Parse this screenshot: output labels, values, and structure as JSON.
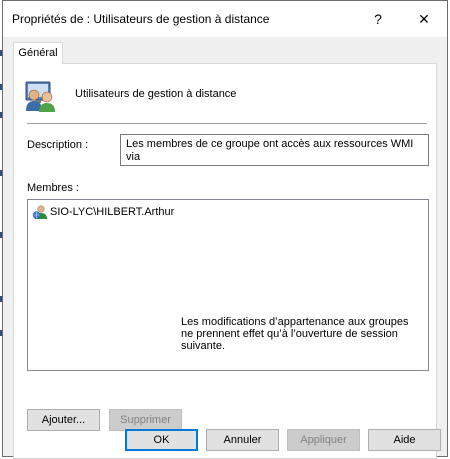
{
  "window": {
    "title": "Propriétés de : Utilisateurs de gestion à distance",
    "help_glyph": "?",
    "close_glyph": "✕"
  },
  "tabs": [
    {
      "label": "Général",
      "selected": true
    }
  ],
  "general": {
    "group_name": "Utilisateurs de gestion à distance",
    "description_label": "Description :",
    "description_value": "Les membres de ce groupe ont accès aux ressources WMI via\ndes protocoles de gestion (tels que  WS-Management via le",
    "members_label": "Membres :",
    "members": [
      {
        "name": "SIO-LYC\\HILBERT.Arthur",
        "icon": "user-domain-icon"
      }
    ],
    "add_button": "Ajouter...",
    "remove_button": "Supprimer",
    "note": "Les modifications d’appartenance aux groupes ne prennent effet qu’à l’ouverture de session suivante."
  },
  "footer": {
    "ok": "OK",
    "cancel": "Annuler",
    "apply": "Appliquer",
    "help": "Aide"
  },
  "colors": {
    "accent": "#0078d7",
    "disabled_text": "#838383"
  }
}
